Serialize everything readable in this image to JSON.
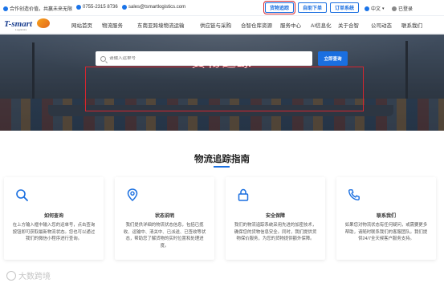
{
  "topbar": {
    "slogan": "合作创造价值，共赢未来无限",
    "phone": "0755-2315 8736",
    "email": "sales@tsmartlogistics.com",
    "buttons": [
      {
        "label": "货物追踪",
        "highlighted": true
      },
      {
        "label": "自助下单",
        "highlighted": false
      },
      {
        "label": "订单系统",
        "highlighted": false
      }
    ],
    "language": "中文",
    "login": "已登录"
  },
  "logo": {
    "text": "T-smart",
    "subtitle": "Logistics"
  },
  "nav": {
    "items": [
      {
        "label": "网站首页"
      },
      {
        "label": "物流服务"
      },
      {
        "label": "东南亚跨境物流运输"
      },
      {
        "label": "供应链与采购"
      },
      {
        "label": "合智仓库资源"
      },
      {
        "label": "服务中心"
      },
      {
        "label": "AI信息化"
      },
      {
        "label": "关于合智"
      },
      {
        "label": "公司动态"
      },
      {
        "label": "联系我们"
      }
    ]
  },
  "hero": {
    "title": "货物追踪",
    "search_placeholder": "请输入运单号",
    "search_button": "立即查询"
  },
  "guide": {
    "title": "物流追踪指南",
    "cards": [
      {
        "icon": "search-icon",
        "title": "如何查询",
        "desc": "在上方输入框中输入您的运单号，点击查询按钮即可获取最新物流状态。您也可以通过我们的微信小程序进行查询。"
      },
      {
        "icon": "location-pin-icon",
        "title": "状态说明",
        "desc": "我们提供详细的物流状态信息，包括已揽收、运输中、清关中、已派送、已签收等状态，帮助您了解货物的实时位置和处理进度。"
      },
      {
        "icon": "lock-icon",
        "title": "安全保障",
        "desc": "我们的物流追踪系统采用先进的加密技术，确保您的货物信息安全。同时，我们提供货物保价服务，为您的货物提供额外保障。"
      },
      {
        "icon": "phone-icon",
        "title": "联系我们",
        "desc": "如果您对物流状态有任何疑问，或需要更多帮助，请随时联系我们的客服团队。我们提供24/7全天候客户服务支持。"
      }
    ]
  },
  "watermark": {
    "text": "大数跨境"
  },
  "colors": {
    "accent": "#1a6fe0",
    "highlight": "#d6262f"
  }
}
